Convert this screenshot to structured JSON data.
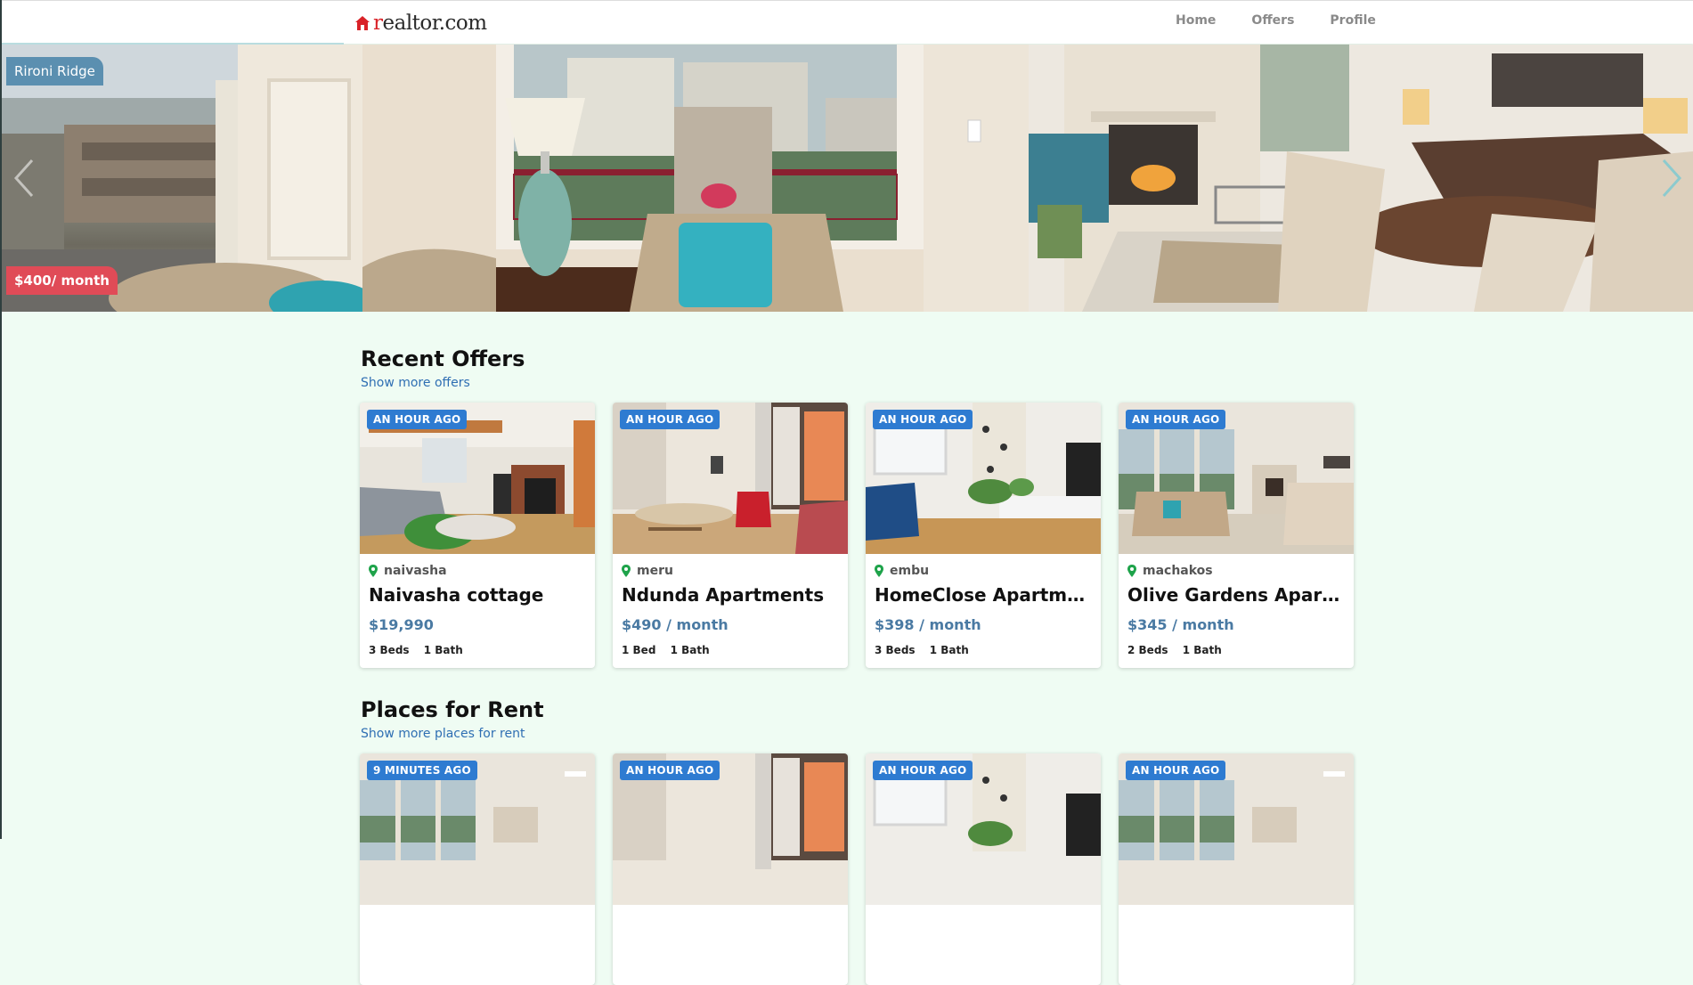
{
  "navbar": {
    "brand": "realtor.com",
    "links": [
      "Home",
      "Offers",
      "Profile"
    ]
  },
  "hero": {
    "name": "Rironi Ridge",
    "price": "$400/ month"
  },
  "sections": [
    {
      "title": "Recent Offers",
      "link": "Show more offers",
      "cards": [
        {
          "badge": "AN HOUR AGO",
          "location": "naivasha",
          "title": "Naivasha cottage",
          "price": "$19,990",
          "beds": "3 Beds",
          "baths": "1 Bath"
        },
        {
          "badge": "AN HOUR AGO",
          "location": "meru",
          "title": "Ndunda Apartments",
          "price": "$490 / month",
          "beds": "1 Bed",
          "baths": "1 Bath"
        },
        {
          "badge": "AN HOUR AGO",
          "location": "embu",
          "title": "HomeClose Apartments",
          "price": "$398 / month",
          "beds": "3 Beds",
          "baths": "1 Bath"
        },
        {
          "badge": "AN HOUR AGO",
          "location": "machakos",
          "title": "Olive Gardens Apartments",
          "price": "$345 / month",
          "beds": "2 Beds",
          "baths": "1 Bath"
        }
      ]
    },
    {
      "title": "Places for Rent",
      "link": "Show more places for rent",
      "cards": [
        {
          "badge": "9 MINUTES AGO"
        },
        {
          "badge": "AN HOUR AGO"
        },
        {
          "badge": "AN HOUR AGO"
        },
        {
          "badge": "AN HOUR AGO"
        }
      ]
    }
  ],
  "colors": {
    "background": "#effcf3",
    "badge_blue": "#2e7bd1",
    "price_blue": "#4a7aa3",
    "hero_name_bg": "#5b8fb0",
    "hero_price_bg": "#e04b57",
    "brand_red": "#d92228"
  }
}
